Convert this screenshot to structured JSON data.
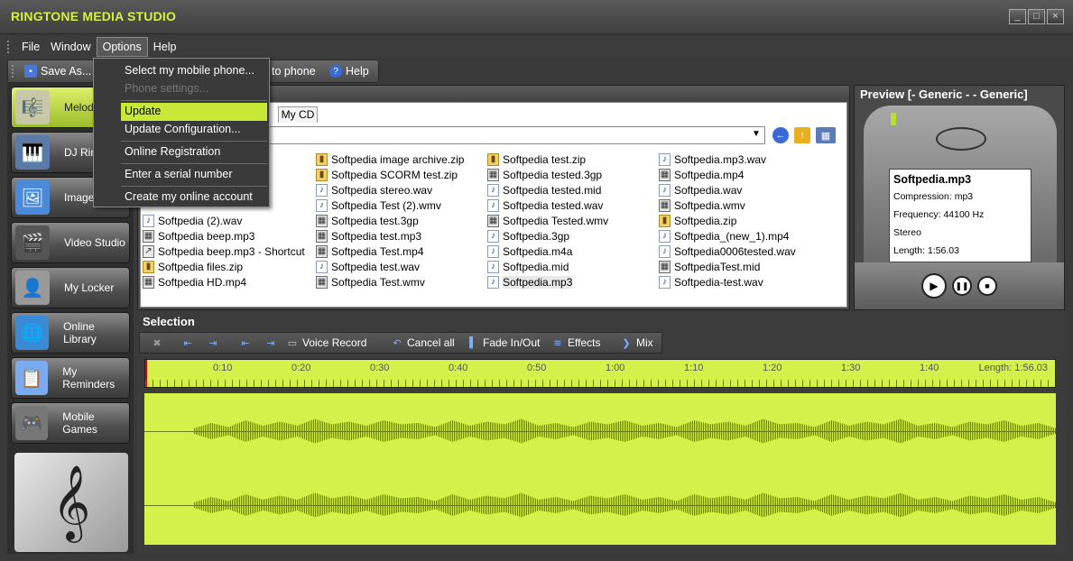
{
  "title": "RINGTONE MEDIA STUDIO",
  "window_controls": [
    "_",
    "□",
    "×"
  ],
  "menu": [
    "File",
    "Window",
    "Options",
    "Help"
  ],
  "toolbar": {
    "save_as": "Save As...",
    "to_phone": "to phone",
    "help": "Help"
  },
  "options_menu": {
    "select_phone": "Select my mobile phone...",
    "phone_settings": "Phone settings...",
    "update": "Update",
    "update_config": "Update Configuration...",
    "online_registration": "Online Registration",
    "serial": "Enter a serial number",
    "create_account": "Create my online account"
  },
  "sidebar": {
    "items": [
      {
        "label": "Melody",
        "icon": "🎼"
      },
      {
        "label": "DJ Ring",
        "icon": "🎹"
      },
      {
        "label": "Image S",
        "icon": "🖼"
      },
      {
        "label": "Video Studio",
        "icon": "🎬"
      },
      {
        "label": "My Locker",
        "icon": "👤"
      },
      {
        "label": "Online Library",
        "icon": "🌐"
      },
      {
        "label": "My Reminders",
        "icon": "📋"
      },
      {
        "label": "Mobile Games",
        "icon": "🎮"
      }
    ],
    "art_glyph": "𝄞"
  },
  "browser": {
    "tab": "My CD",
    "files": {
      "col1": [
        {
          "name": "Softpedia (2).wav",
          "type": "music"
        },
        {
          "name": "Softpedia beep.mp3",
          "type": "video"
        },
        {
          "name": "Softpedia beep.mp3 - Shortcut",
          "type": "video"
        },
        {
          "name": "Softpedia files.zip",
          "type": "zip"
        },
        {
          "name": "Softpedia HD.mp4",
          "type": "video"
        }
      ],
      "col2": [
        {
          "name": "Softpedia image archive.zip",
          "type": "zip"
        },
        {
          "name": "Softpedia SCORM test.zip",
          "type": "zip"
        },
        {
          "name": "Softpedia stereo.wav",
          "type": "music"
        },
        {
          "name": "Softpedia Test (2).wmv",
          "type": "music"
        },
        {
          "name": "Softpedia test.3gp",
          "type": "video"
        },
        {
          "name": "Softpedia test.mp3",
          "type": "video"
        },
        {
          "name": "Softpedia Test.mp4",
          "type": "video"
        },
        {
          "name": "Softpedia test.wav",
          "type": "music"
        },
        {
          "name": "Softpedia Test.wmv",
          "type": "video"
        }
      ],
      "col3": [
        {
          "name": "Softpedia test.zip",
          "type": "zip"
        },
        {
          "name": "Softpedia tested.3gp",
          "type": "video"
        },
        {
          "name": "Softpedia tested.mid",
          "type": "music"
        },
        {
          "name": "Softpedia tested.wav",
          "type": "music"
        },
        {
          "name": "Softpedia Tested.wmv",
          "type": "video"
        },
        {
          "name": "Softpedia.3gp",
          "type": "music"
        },
        {
          "name": "Softpedia.m4a",
          "type": "music"
        },
        {
          "name": "Softpedia.mid",
          "type": "music"
        },
        {
          "name": "Softpedia.mp3",
          "type": "music"
        }
      ],
      "col4": [
        {
          "name": "Softpedia.mp3.wav",
          "type": "music"
        },
        {
          "name": "Softpedia.mp4",
          "type": "video"
        },
        {
          "name": "Softpedia.wav",
          "type": "music"
        },
        {
          "name": "Softpedia.wmv",
          "type": "video"
        },
        {
          "name": "Softpedia.zip",
          "type": "zip"
        },
        {
          "name": "Softpedia_(new_1).mp4",
          "type": "music"
        },
        {
          "name": "Softpedia0006tested.wav",
          "type": "music"
        },
        {
          "name": "SoftpediaTest.mid",
          "type": "video"
        },
        {
          "name": "Softpedia-test.wav",
          "type": "music"
        }
      ]
    }
  },
  "preview": {
    "title": "Preview [- Generic - - Generic]",
    "file": "Softpedia.mp3",
    "compression": "Compression: mp3",
    "frequency": "Frequency: 44100 Hz",
    "channels": "Stereo",
    "length": "Length: 1:56.03"
  },
  "selection": {
    "title": "Selection",
    "voice_record": "Voice Record",
    "cancel_all": "Cancel all",
    "fade": "Fade In/Out",
    "effects": "Effects",
    "mix": "Mix",
    "ruler_ticks": [
      "0:10",
      "0:20",
      "0:30",
      "0:40",
      "0:50",
      "1:00",
      "1:10",
      "1:20",
      "1:30",
      "1:40"
    ],
    "length_label": "Length: 1:56.03"
  },
  "colors": {
    "accent": "#d4f04a",
    "title_text": "#d8f040"
  }
}
